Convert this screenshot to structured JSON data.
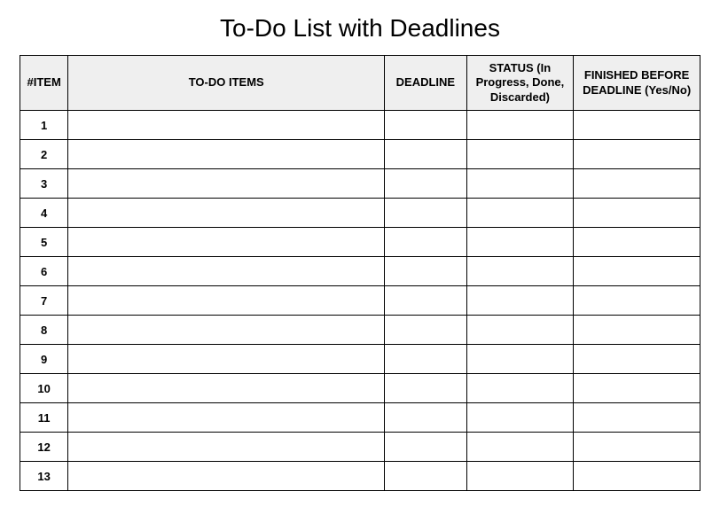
{
  "title": "To-Do List with Deadlines",
  "headers": {
    "item": "#ITEM",
    "todo": "TO-DO ITEMS",
    "deadline": "DEADLINE",
    "status": "STATUS (In Progress, Done, Discarded)",
    "finished": "FINISHED BEFORE DEADLINE (Yes/No)"
  },
  "rows": [
    {
      "num": "1",
      "todo": "",
      "deadline": "",
      "status": "",
      "finished": ""
    },
    {
      "num": "2",
      "todo": "",
      "deadline": "",
      "status": "",
      "finished": ""
    },
    {
      "num": "3",
      "todo": "",
      "deadline": "",
      "status": "",
      "finished": ""
    },
    {
      "num": "4",
      "todo": "",
      "deadline": "",
      "status": "",
      "finished": ""
    },
    {
      "num": "5",
      "todo": "",
      "deadline": "",
      "status": "",
      "finished": ""
    },
    {
      "num": "6",
      "todo": "",
      "deadline": "",
      "status": "",
      "finished": ""
    },
    {
      "num": "7",
      "todo": "",
      "deadline": "",
      "status": "",
      "finished": ""
    },
    {
      "num": "8",
      "todo": "",
      "deadline": "",
      "status": "",
      "finished": ""
    },
    {
      "num": "9",
      "todo": "",
      "deadline": "",
      "status": "",
      "finished": ""
    },
    {
      "num": "10",
      "todo": "",
      "deadline": "",
      "status": "",
      "finished": ""
    },
    {
      "num": "11",
      "todo": "",
      "deadline": "",
      "status": "",
      "finished": ""
    },
    {
      "num": "12",
      "todo": "",
      "deadline": "",
      "status": "",
      "finished": ""
    },
    {
      "num": "13",
      "todo": "",
      "deadline": "",
      "status": "",
      "finished": ""
    }
  ]
}
